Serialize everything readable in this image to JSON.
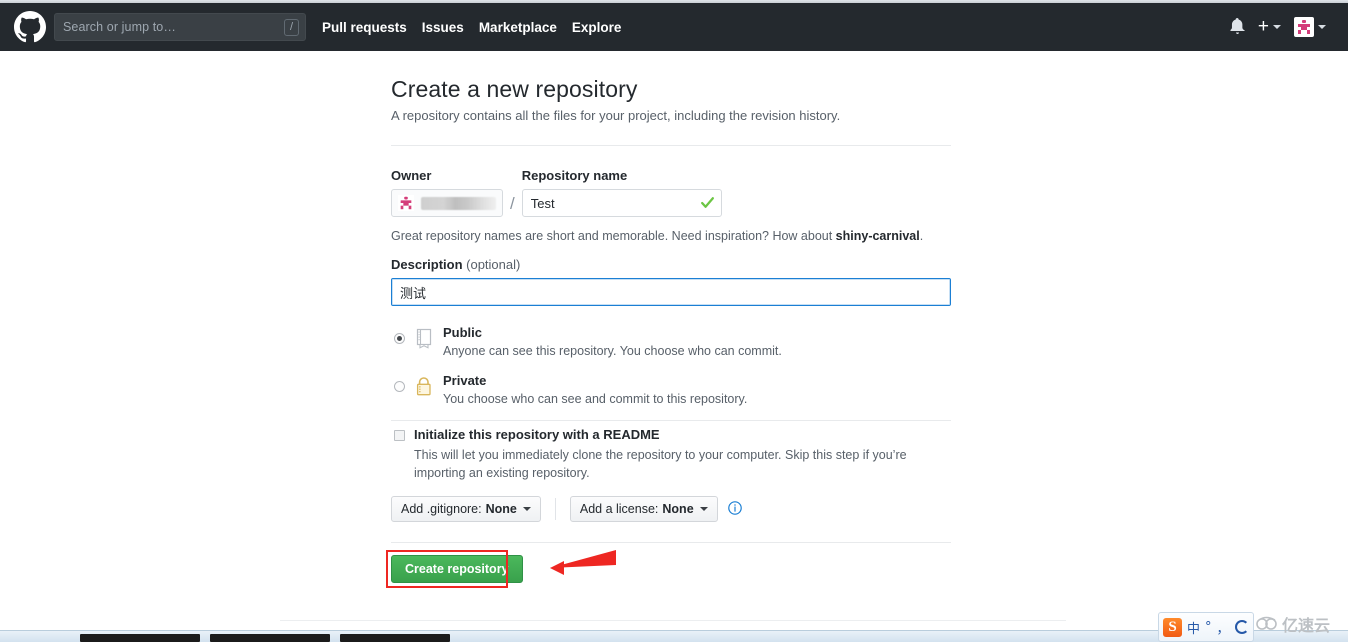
{
  "header": {
    "logo_icon": "github-octocat-logo",
    "search": {
      "placeholder": "Search or jump to…",
      "shortcut_badge": "/"
    },
    "nav": [
      {
        "label": "Pull requests"
      },
      {
        "label": "Issues"
      },
      {
        "label": "Marketplace"
      },
      {
        "label": "Explore"
      }
    ],
    "right": {
      "notifications_icon": "bell-icon",
      "create_new_icon": "plus-icon",
      "avatar_icon": "user-avatar",
      "caret_icon": "chevron-down-icon"
    },
    "background_color": "#24292e"
  },
  "form": {
    "title": "Create a new repository",
    "subtitle": "A repository contains all the files for your project, including the revision history.",
    "owner": {
      "label": "Owner",
      "avatar_icon": "owner-avatar-icon",
      "value": "",
      "redacted": true
    },
    "separator": "/",
    "repo_name": {
      "label": "Repository name",
      "value": "Test",
      "placeholder": "",
      "valid_icon": "check-icon",
      "valid_color": "#6cc644"
    },
    "hint": {
      "prefix": "Great repository names are short and memorable. Need inspiration? How about ",
      "suggestion": "shiny-carnival",
      "suffix": "."
    },
    "description": {
      "label": "Description",
      "label_optional": "(optional)",
      "value": "测试",
      "placeholder": "",
      "focus_border_color": "#1b7fd4"
    },
    "visibility": [
      {
        "id": "public",
        "title": "Public",
        "description": "Anyone can see this repository. You choose who can commit.",
        "icon": "repo-book-icon",
        "selected": true
      },
      {
        "id": "private",
        "title": "Private",
        "description": "You choose who can see and commit to this repository.",
        "icon": "lock-icon",
        "selected": false
      }
    ],
    "readme": {
      "title": "Initialize this repository with a README",
      "description": "This will let you immediately clone the repository to your computer. Skip this step if you’re importing an existing repository.",
      "checked": false
    },
    "gitignore_button": {
      "prefix": "Add .gitignore: ",
      "value": "None",
      "caret_icon": "chevron-down-icon"
    },
    "license_button": {
      "prefix": "Add a license: ",
      "value": "None",
      "caret_icon": "chevron-down-icon"
    },
    "info_icon": "info-circle-icon",
    "submit": {
      "label": "Create repository",
      "color": "#39a14c"
    }
  },
  "annotations": {
    "highlight_box_color": "#ee2722",
    "arrow_color": "#ee2722",
    "arrow_target": "create-repository-button"
  },
  "ime": {
    "logo": "S",
    "items": [
      "中",
      "°",
      "，"
    ],
    "circle_icon": "ime-circle-icon"
  },
  "watermark": {
    "logo_icon": "cloud-logo-icon",
    "text": "亿速云"
  }
}
